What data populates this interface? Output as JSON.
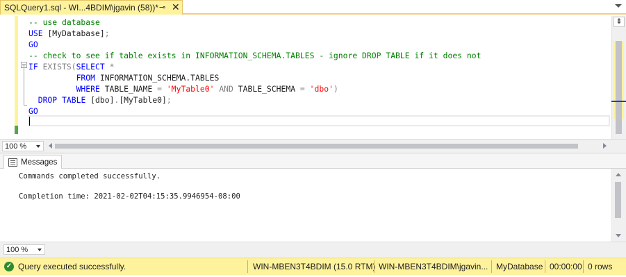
{
  "tab": {
    "title": "SQLQuery1.sql - WI...4BDIM\\jgavin (58))*",
    "pin_glyph": "⊸",
    "close_glyph": "✕"
  },
  "editor": {
    "lines": [
      {
        "parts": [
          {
            "c": "cm",
            "t": "-- use database"
          }
        ]
      },
      {
        "parts": [
          {
            "c": "kw",
            "t": "USE "
          },
          {
            "c": "txt",
            "t": "[MyDatabase]"
          },
          {
            "c": "gy",
            "t": ";"
          }
        ]
      },
      {
        "parts": [
          {
            "c": "kw",
            "t": "GO"
          }
        ]
      },
      {
        "parts": [
          {
            "c": "cm",
            "t": "-- check to see if table exists in INFORMATION_SCHEMA.TABLES - ignore DROP TABLE if it does not"
          }
        ]
      },
      {
        "parts": [
          {
            "c": "kw",
            "t": "IF "
          },
          {
            "c": "gy",
            "t": "EXISTS("
          },
          {
            "c": "kw",
            "t": "SELECT "
          },
          {
            "c": "gy",
            "t": "*"
          }
        ]
      },
      {
        "parts": [
          {
            "c": "txt",
            "t": "          "
          },
          {
            "c": "kw",
            "t": "FROM "
          },
          {
            "c": "txt",
            "t": "INFORMATION_SCHEMA.TABLES"
          }
        ]
      },
      {
        "parts": [
          {
            "c": "txt",
            "t": "          "
          },
          {
            "c": "kw",
            "t": "WHERE "
          },
          {
            "c": "txt",
            "t": "TABLE_NAME "
          },
          {
            "c": "gy",
            "t": "= "
          },
          {
            "c": "str",
            "t": "'MyTable0' "
          },
          {
            "c": "gy",
            "t": "AND "
          },
          {
            "c": "txt",
            "t": "TABLE_SCHEMA "
          },
          {
            "c": "gy",
            "t": "= "
          },
          {
            "c": "str",
            "t": "'dbo'"
          },
          {
            "c": "gy",
            "t": ")"
          }
        ]
      },
      {
        "parts": [
          {
            "c": "txt",
            "t": "  "
          },
          {
            "c": "kw",
            "t": "DROP TABLE "
          },
          {
            "c": "txt",
            "t": "[dbo]"
          },
          {
            "c": "gy",
            "t": "."
          },
          {
            "c": "txt",
            "t": "[MyTable0]"
          },
          {
            "c": "gy",
            "t": ";"
          }
        ]
      },
      {
        "parts": [
          {
            "c": "kw",
            "t": "GO"
          }
        ]
      },
      {
        "parts": [
          {
            "c": "txt",
            "t": ""
          }
        ]
      }
    ],
    "zoom": "100 %",
    "split_glyph": "⇟"
  },
  "results": {
    "tab_label": "Messages",
    "messages": [
      "Commands completed successfully.",
      "Completion time: 2021-02-02T04:15:35.9946954-08:00"
    ],
    "zoom": "100 %"
  },
  "status": {
    "ok_glyph": "✓",
    "message": "Query executed successfully.",
    "server": "WIN-MBEN3T4BDIM (15.0 RTM)",
    "user": "WIN-MBEN3T4BDIM\\jgavin...",
    "database": "MyDatabase",
    "elapsed": "00:00:00",
    "rows": "0 rows"
  },
  "colors": {
    "tab_yellow": "#fff29d",
    "keyword_blue": "#0000ff",
    "comment_green": "#008000",
    "string_red": "#ff0000",
    "status_green": "#2e8b2e"
  }
}
